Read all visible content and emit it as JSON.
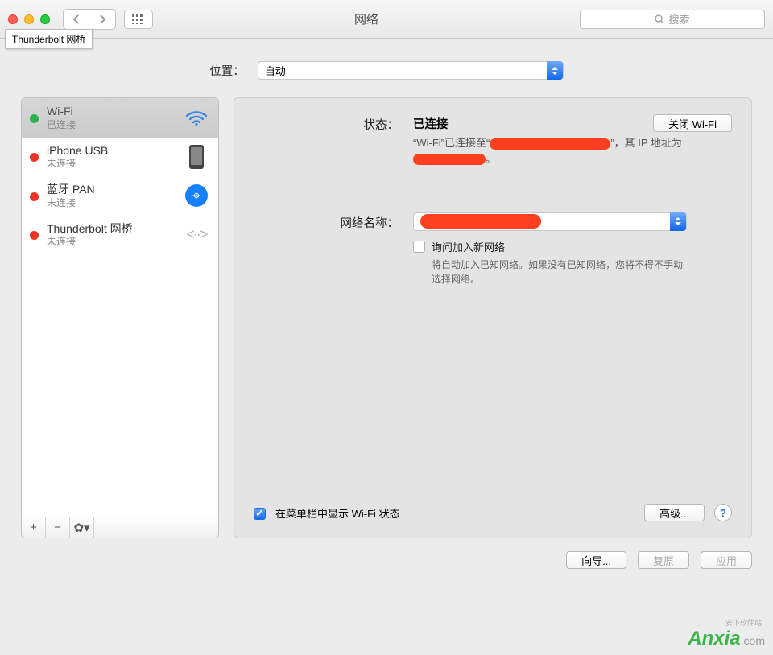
{
  "window": {
    "title": "网络",
    "tooltip": "Thunderbolt 网桥"
  },
  "search": {
    "placeholder": "搜索"
  },
  "location": {
    "label": "位置：",
    "value": "自动"
  },
  "sidebar": {
    "items": [
      {
        "title": "Wi-Fi",
        "sub": "已连接",
        "status": "green",
        "icon": "wifi"
      },
      {
        "title": "iPhone USB",
        "sub": "未连接",
        "status": "red",
        "icon": "phone"
      },
      {
        "title": "蓝牙 PAN",
        "sub": "未连接",
        "status": "red",
        "icon": "bluetooth"
      },
      {
        "title": "Thunderbolt 网桥",
        "sub": "未连接",
        "status": "red",
        "icon": "thunderbolt"
      }
    ]
  },
  "detail": {
    "status_label": "状态：",
    "status_value": "已连接",
    "toggle_btn": "关闭 Wi-Fi",
    "sub_prefix": "“Wi-Fi”已连接至“",
    "sub_mid": "”，其 IP 地址为",
    "sub_end": "。",
    "netname_label": "网络名称：",
    "ask_join": "询问加入新网络",
    "ask_hint": "将自动加入已知网络。如果没有已知网络，您将不得不手动选择网络。",
    "menubar_label": "在菜单栏中显示 Wi-Fi 状态",
    "advanced": "高级..."
  },
  "buttons": {
    "wizard": "向导...",
    "revert": "复原",
    "apply": "应用"
  },
  "watermark": {
    "brand": "Anxia",
    "domain": ".com",
    "sub": "安下软件站"
  }
}
